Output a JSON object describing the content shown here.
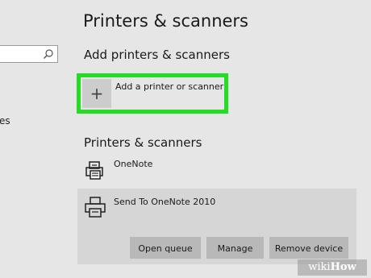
{
  "sidebar": {
    "search_placeholder": "",
    "fragment_text": "es"
  },
  "header": {
    "title": "Printers & scanners"
  },
  "add_section": {
    "title": "Add printers & scanners",
    "plus_glyph": "+",
    "add_label": "Add a printer or scanner",
    "highlight_color": "#22dd22"
  },
  "list_section": {
    "title": "Printers & scanners",
    "devices": [
      {
        "name": "OneNote",
        "icon": "fax-printer-icon"
      },
      {
        "name": "Send To OneNote 2010",
        "icon": "printer-icon"
      }
    ]
  },
  "selected_device_actions": {
    "open_queue": "Open queue",
    "manage": "Manage",
    "remove_device": "Remove device"
  },
  "watermark": {
    "wiki": "wiki",
    "how": "How"
  }
}
